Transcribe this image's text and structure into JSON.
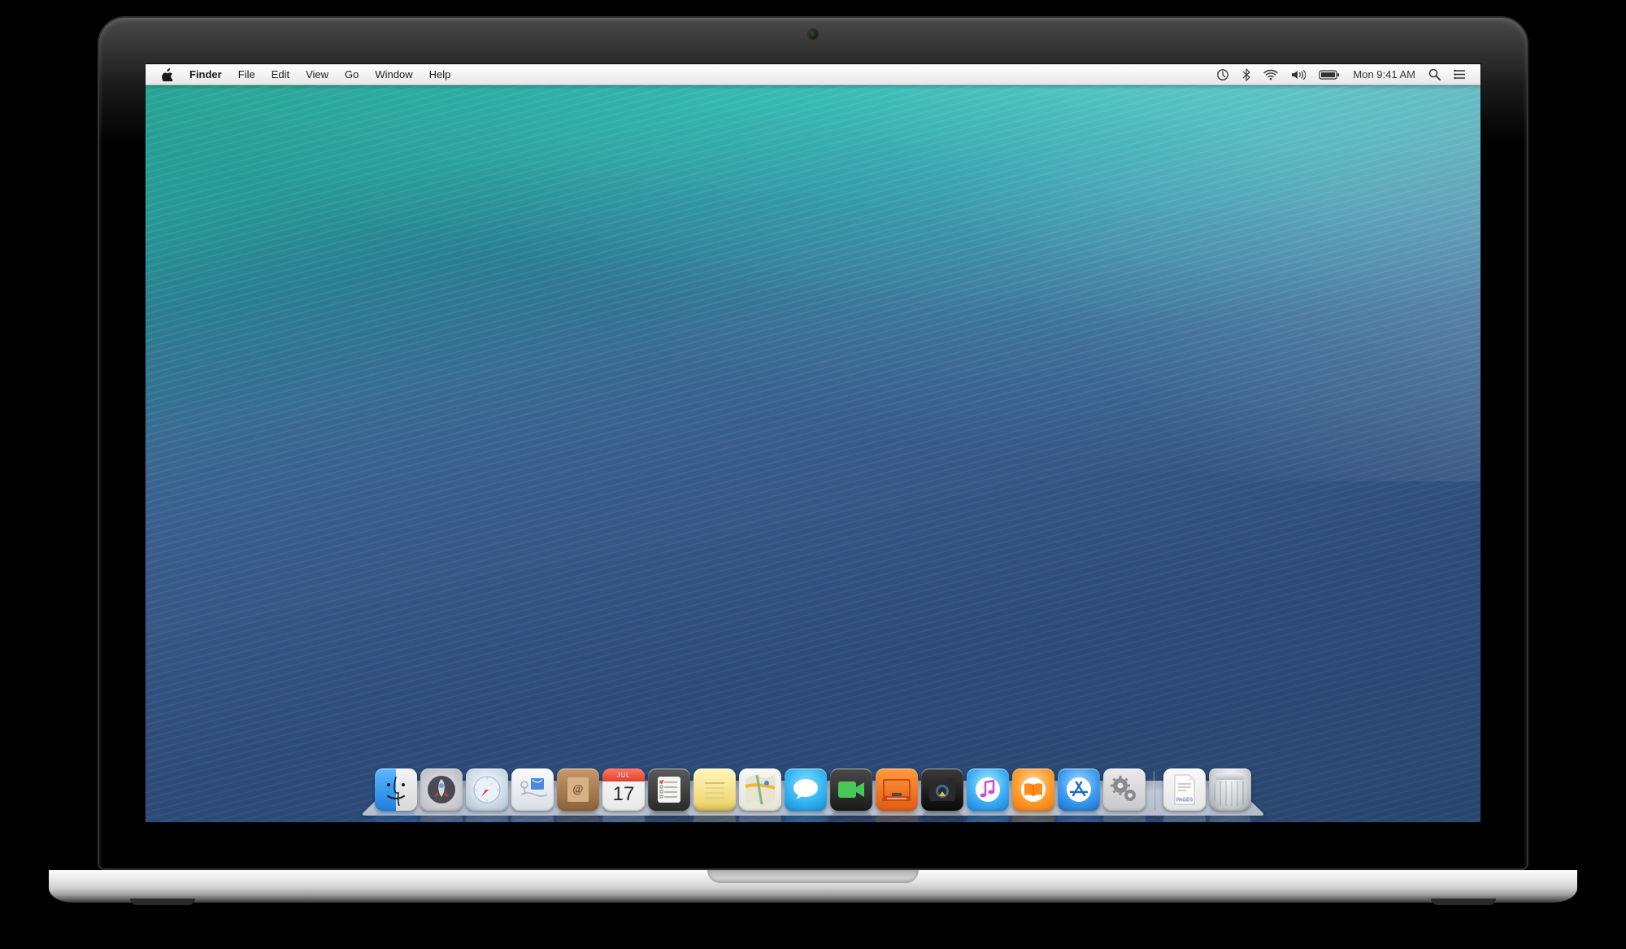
{
  "menubar": {
    "app": "Finder",
    "items": [
      "File",
      "Edit",
      "View",
      "Go",
      "Window",
      "Help"
    ],
    "clock": "Mon 9:41 AM"
  },
  "calendar": {
    "month": "JUL",
    "day": "17"
  },
  "dock": {
    "apps": [
      {
        "name": "Finder",
        "class": "i-finder"
      },
      {
        "name": "Launchpad",
        "class": "i-launchpad"
      },
      {
        "name": "Safari",
        "class": "i-safari"
      },
      {
        "name": "Mail",
        "class": "i-mail"
      },
      {
        "name": "Contacts",
        "class": "i-contacts"
      },
      {
        "name": "Calendar",
        "class": "i-calendar"
      },
      {
        "name": "Reminders",
        "class": "i-reminders"
      },
      {
        "name": "Notes",
        "class": "i-notes"
      },
      {
        "name": "Maps",
        "class": "i-maps"
      },
      {
        "name": "Messages",
        "class": "i-messages"
      },
      {
        "name": "FaceTime",
        "class": "i-facetime"
      },
      {
        "name": "Photo Booth",
        "class": "i-photobooth"
      },
      {
        "name": "iPhoto",
        "class": "i-iphoto"
      },
      {
        "name": "iTunes",
        "class": "i-itunes"
      },
      {
        "name": "iBooks",
        "class": "i-ibooks"
      },
      {
        "name": "App Store",
        "class": "i-appstore"
      },
      {
        "name": "System Preferences",
        "class": "i-sysprefs"
      }
    ],
    "right": [
      {
        "name": "Pages document",
        "class": "i-pages"
      },
      {
        "name": "Trash",
        "class": "i-trash"
      }
    ]
  }
}
